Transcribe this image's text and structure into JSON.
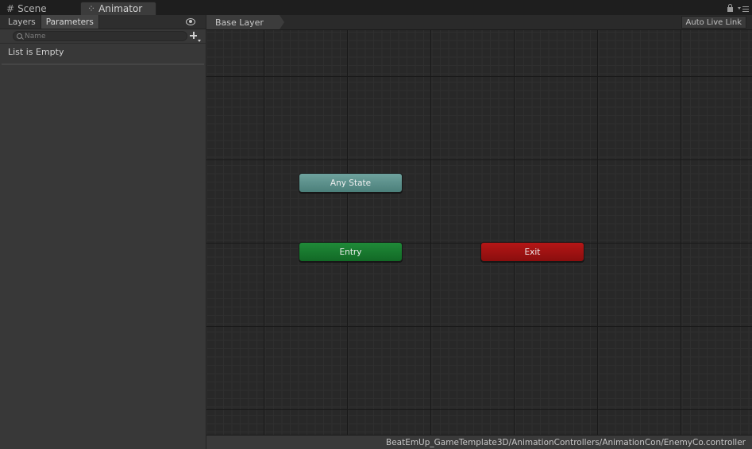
{
  "window": {
    "tabs": [
      {
        "label": "Scene",
        "icon": "scene-grid-icon"
      },
      {
        "label": "Animator",
        "icon": "animator-icon"
      }
    ],
    "active_tab": "Animator"
  },
  "left_panel": {
    "tabs": [
      "Layers",
      "Parameters"
    ],
    "active_tab": "Parameters",
    "search": {
      "placeholder": "Name",
      "value": ""
    },
    "empty_message": "List is Empty"
  },
  "graph": {
    "breadcrumb": "Base Layer",
    "live_link_label": "Auto Live Link",
    "nodes": {
      "any_state": {
        "label": "Any State",
        "color": "#5f938e"
      },
      "entry": {
        "label": "Entry",
        "color": "#187a2f"
      },
      "exit": {
        "label": "Exit",
        "color": "#a01212"
      }
    }
  },
  "status_bar": {
    "path": "BeatEmUp_GameTemplate3D/AnimationControllers/AnimationCon/EnemyCo.controller"
  }
}
